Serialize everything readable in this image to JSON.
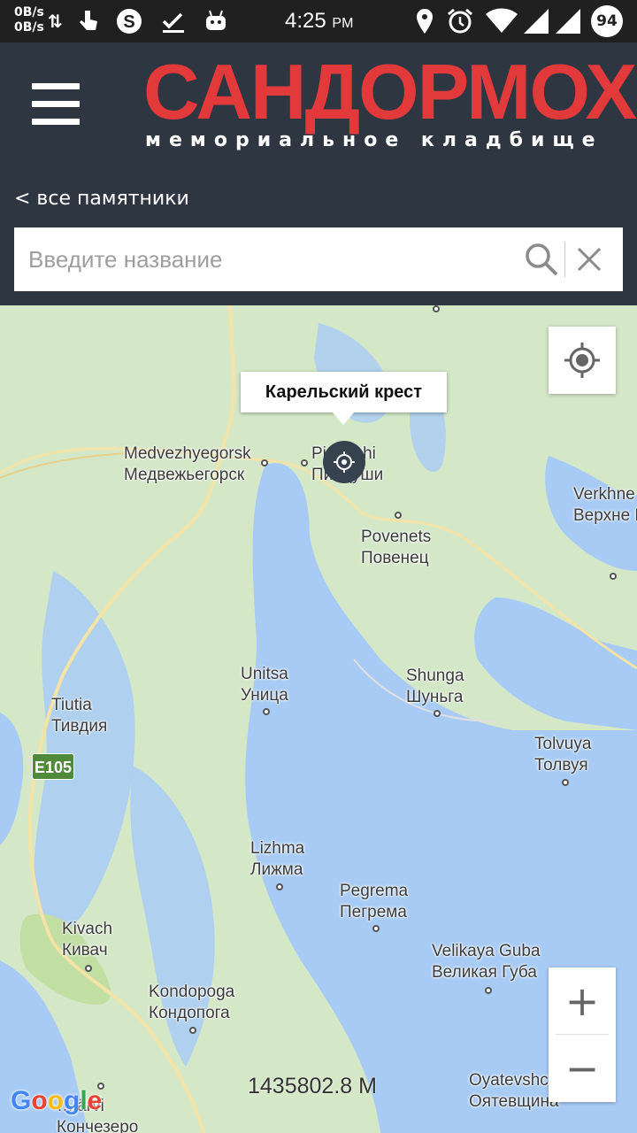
{
  "status_bar": {
    "net_up": "0B/s",
    "net_down": "0B/s",
    "time": "4:25",
    "ampm": "PM",
    "battery": "94"
  },
  "header": {
    "title": "САНДОРМОХ",
    "subtitle": "мемориальное кладбище",
    "accent_color": "#e23a3a",
    "background_color": "#2e3642"
  },
  "nav": {
    "back_label": "< все памятники"
  },
  "search": {
    "placeholder": "Введите название",
    "value": ""
  },
  "map": {
    "tooltip": "Карельский крест",
    "road_label": "E105",
    "distance": "1435802.8 M",
    "zoom_in": "+",
    "zoom_out": "−",
    "places": [
      {
        "en": "Medvezhyegorsk",
        "ru": "Медвежьегорск"
      },
      {
        "en": "Pindushi",
        "ru": "Пиндуши"
      },
      {
        "en": "Verkhne Volozer",
        "ru": "Верхне Волозер"
      },
      {
        "en": "Povenets",
        "ru": "Повенец"
      },
      {
        "en": "Unitsa",
        "ru": "Уница"
      },
      {
        "en": "Shunga",
        "ru": "Шуньга"
      },
      {
        "en": "Tiutia",
        "ru": "Тивдия"
      },
      {
        "en": "Tolvuya",
        "ru": "Толвуя"
      },
      {
        "en": "Lizhma",
        "ru": "Лижма"
      },
      {
        "en": "Pegrema",
        "ru": "Пегрема"
      },
      {
        "en": "Kivach",
        "ru": "Кивач"
      },
      {
        "en": "Velikaya Guba",
        "ru": "Великая Губа"
      },
      {
        "en": "Kondopoga",
        "ru": "Кондопога"
      },
      {
        "en": "Oyatevshchina",
        "ru": "Оятевщина"
      },
      {
        "en": "…järvi",
        "ru": "Кончезеро"
      }
    ]
  },
  "icons": {
    "menu": "hamburger-icon",
    "search": "search-icon",
    "clear": "close-icon",
    "locate": "my-location-icon",
    "marker": "memorial-marker-icon"
  }
}
